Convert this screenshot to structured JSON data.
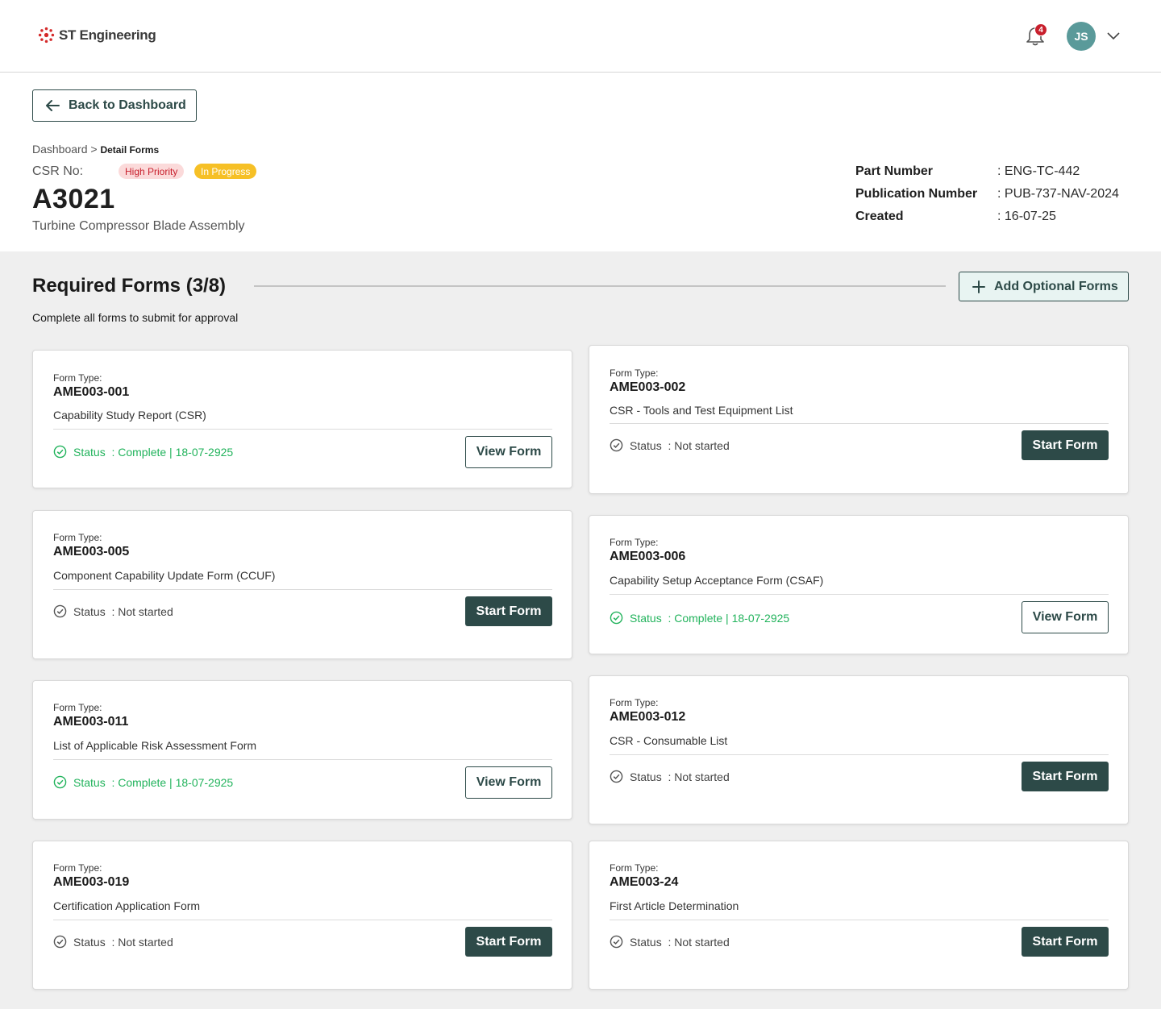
{
  "header": {
    "logo_text": "ST Engineering",
    "notification_count": "4",
    "avatar_initials": "JS"
  },
  "nav": {
    "back_label": "Back to Dashboard",
    "breadcrumb_root": "Dashboard",
    "breadcrumb_sep": " > ",
    "breadcrumb_current": "Detail Forms"
  },
  "csr": {
    "label": "CSR No:",
    "priority_badge": "High Priority",
    "status_badge": "In Progress",
    "number": "A3021",
    "description": "Turbine Compressor Blade Assembly"
  },
  "meta": {
    "part_number_label": "Part Number",
    "part_number_value": ": ENG-TC-442",
    "publication_label": "Publication Number",
    "publication_value": ": PUB-737-NAV-2024",
    "created_label": "Created",
    "created_value": ": 16-07-25"
  },
  "section": {
    "title": "Required Forms (3/8)",
    "subtitle": "Complete all forms to submit for approval",
    "add_label": "Add Optional Forms"
  },
  "colors": {
    "primary": "#2d4a48",
    "complete_green": "#22b35c",
    "high_priority_bg": "#fbdada",
    "in_progress_bg": "#f6c026",
    "notification_red": "#c8202d",
    "avatar_bg": "#5a9a9a"
  },
  "form_type_label": "Form Type:",
  "forms": [
    {
      "code": "AME003-001",
      "name": "Capability Study Report (CSR)",
      "status": "Status  : Complete | 18-07-2925",
      "complete": true,
      "button": "View Form"
    },
    {
      "code": "AME003-002",
      "name": "CSR - Tools and Test Equipment List",
      "status": "Status  : Not started",
      "complete": false,
      "button": "Start Form"
    },
    {
      "code": "AME003-005",
      "name": "Component Capability Update Form (CCUF)",
      "status": "Status  : Not started",
      "complete": false,
      "button": "Start Form"
    },
    {
      "code": "AME003-006",
      "name": "Capability Setup Acceptance Form (CSAF)",
      "status": "Status  : Complete | 18-07-2925",
      "complete": true,
      "button": "View Form"
    },
    {
      "code": "AME003-011",
      "name": "List of Applicable Risk Assessment Form",
      "status": "Status  : Complete | 18-07-2925",
      "complete": true,
      "button": "View Form"
    },
    {
      "code": "AME003-012",
      "name": "CSR - Consumable List",
      "status": "Status  : Not started",
      "complete": false,
      "button": "Start Form"
    },
    {
      "code": "AME003-019",
      "name": "Certification Application Form",
      "status": "Status  : Not started",
      "complete": false,
      "button": "Start Form"
    },
    {
      "code": "AME003-24",
      "name": "First Article Determination",
      "status": "Status  : Not started",
      "complete": false,
      "button": "Start Form"
    }
  ]
}
